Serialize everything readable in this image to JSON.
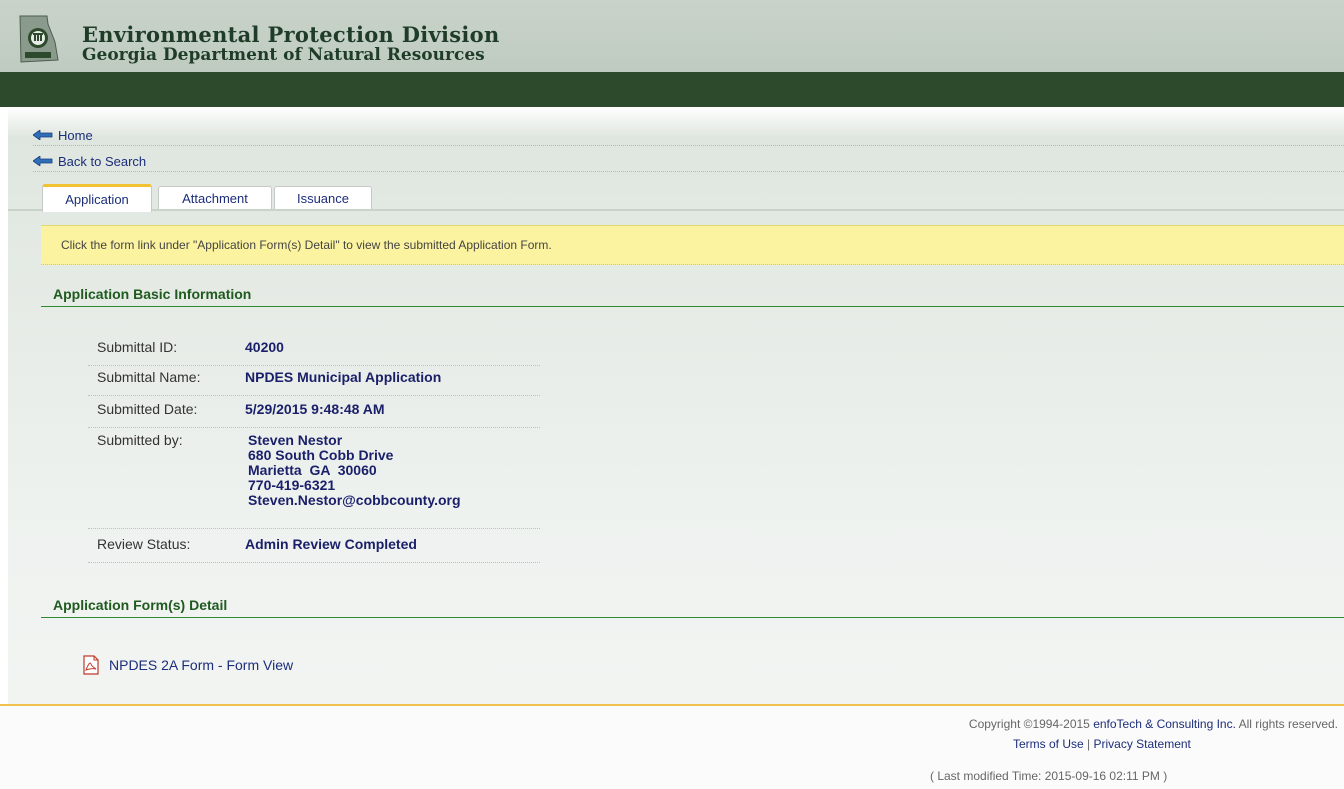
{
  "header": {
    "title": "Environmental Protection Division",
    "subtitle": "Georgia Department of Natural Resources"
  },
  "nav": {
    "home": "Home",
    "back": "Back to Search"
  },
  "tabs": [
    {
      "label": "Application",
      "active": true
    },
    {
      "label": "Attachment",
      "active": false
    },
    {
      "label": "Issuance",
      "active": false
    }
  ],
  "notice": "Click the form link under \"Application Form(s) Detail\" to view the submitted Application Form.",
  "basic": {
    "title": "Application Basic Information",
    "rows": [
      {
        "label": "Submittal ID:",
        "value": "40200"
      },
      {
        "label": "Submittal Name:",
        "value": "NPDES Municipal Application"
      },
      {
        "label": "Submitted Date:",
        "value": "5/29/2015 9:48:48 AM"
      },
      {
        "label": "Submitted by:",
        "lines": [
          "Steven Nestor",
          "680 South Cobb Drive",
          "Marietta  GA  30060",
          "770-419-6321",
          "Steven.Nestor@cobbcounty.org"
        ]
      },
      {
        "label": "Review Status:",
        "value": "Admin Review Completed"
      }
    ]
  },
  "forms": {
    "title": "Application Form(s) Detail",
    "link": "NPDES 2A Form - Form View",
    "icon": "pdf-icon"
  },
  "footer": {
    "copyright_prefix": "Copyright ©1994-2015 ",
    "company": "enfoTech & Consulting Inc.",
    "copyright_suffix": " All rights reserved.",
    "terms": "Terms of Use",
    "separator": "|",
    "privacy": "Privacy Statement",
    "modified": "( Last modified Time: 2015-09-16 02:11 PM )"
  },
  "colors": {
    "header_bg": "#c9d3ca",
    "bar_bg": "#2e4a2c",
    "link": "#1c2e7a",
    "value": "#1a1f6a",
    "section": "#1f5a1f",
    "notice_bg": "#fcf3a0",
    "footer_line": "#f2c14e"
  }
}
